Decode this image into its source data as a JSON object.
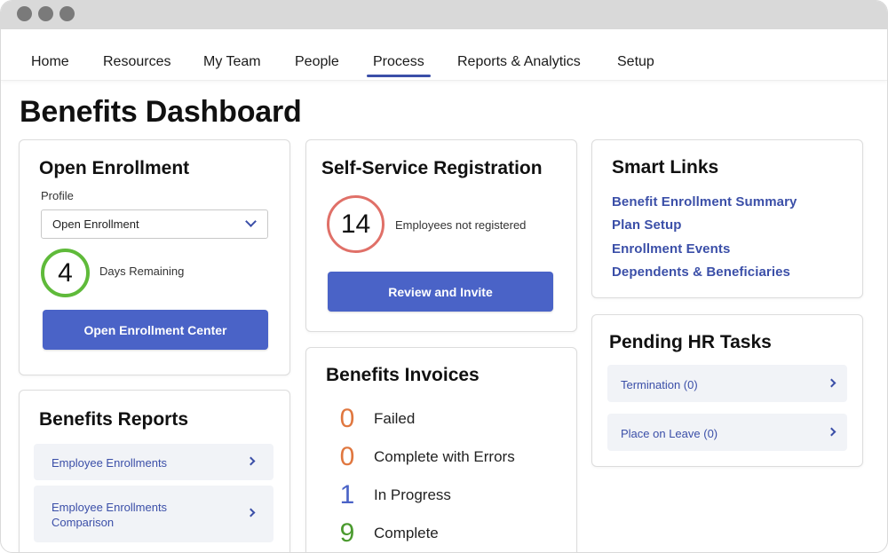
{
  "colors": {
    "accent": "#3b4fa8",
    "button": "#4a63c7",
    "ring_green": "#5fba3a",
    "ring_red": "#e07068",
    "failed": "#e0773f",
    "errors": "#e0773f",
    "in_progress": "#4a63c7",
    "complete": "#4a9a2e"
  },
  "nav": {
    "items": [
      "Home",
      "Resources",
      "My Team",
      "People",
      "Process",
      "Reports & Analytics",
      "Setup"
    ],
    "active": "Process"
  },
  "page": {
    "title": "Benefits Dashboard"
  },
  "open_enrollment": {
    "title": "Open Enrollment",
    "profile_label": "Profile",
    "profile_value": "Open Enrollment",
    "days": "4",
    "days_label": "Days Remaining",
    "button": "Open Enrollment Center"
  },
  "self_service": {
    "title": "Self-Service Registration",
    "count": "14",
    "count_label": "Employees not registered",
    "button": "Review and Invite"
  },
  "smart_links": {
    "title": "Smart Links",
    "links": [
      "Benefit Enrollment Summary",
      "Plan Setup",
      "Enrollment Events",
      "Dependents & Beneficiaries"
    ]
  },
  "benefits_reports": {
    "title": "Benefits Reports",
    "items": [
      "Employee Enrollments",
      "Employee Enrollments Comparison"
    ]
  },
  "benefits_invoices": {
    "title": "Benefits Invoices",
    "rows": [
      {
        "count": "0",
        "label": "Failed"
      },
      {
        "count": "0",
        "label": "Complete with Errors"
      },
      {
        "count": "1",
        "label": "In Progress"
      },
      {
        "count": "9",
        "label": "Complete"
      }
    ]
  },
  "pending_hr": {
    "title": "Pending HR Tasks",
    "items": [
      "Termination (0)",
      "Place on Leave (0)"
    ]
  }
}
